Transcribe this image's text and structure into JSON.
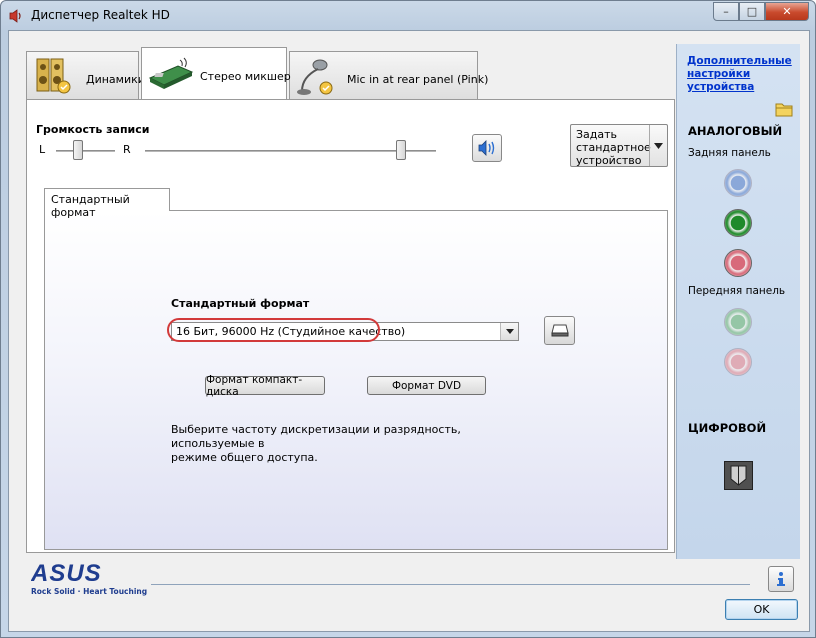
{
  "window": {
    "title": "Диспетчер Realtek HD",
    "min_glyph": "–",
    "max_glyph": "□",
    "close_glyph": "✕"
  },
  "tabs": [
    {
      "label": "Динамики",
      "icon": "speakers-icon",
      "active": false
    },
    {
      "label": "Стерео микшер",
      "icon": "stereo-mixer-icon",
      "active": true
    },
    {
      "label": "Mic in at rear panel (Pink)",
      "icon": "microphone-icon",
      "active": false
    }
  ],
  "recording": {
    "title": "Громкость записи",
    "left_label": "L",
    "right_label": "R",
    "balance_position": 0.5,
    "volume_level": 0.87
  },
  "default_device": {
    "label_line1": "Задать",
    "label_line2": "стандартное",
    "label_line3": "устройство"
  },
  "format": {
    "tab_label": "Стандартный формат",
    "section_title": "Стандартный формат",
    "selected": "16 Бит, 96000 Hz (Студийное качество)",
    "cd_button": "Формат компакт-диска",
    "dvd_button": "Формат DVD",
    "description_line1": "Выберите частоту дискретизации и разрядность, используемые в",
    "description_line2": "режиме общего доступа."
  },
  "sidebar": {
    "link_line1": "Дополнительные",
    "link_line2": "настройки",
    "link_line3": "устройства",
    "analog_heading": "АНАЛОГОВЫЙ",
    "rear_panel": "Задняя панель",
    "front_panel": "Передняя панель",
    "digital_heading": "ЦИФРОВОЙ"
  },
  "jacks": [
    {
      "name": "rear-blue",
      "color": "#7f9fd6",
      "active": false
    },
    {
      "name": "rear-green",
      "color": "#1f8a2a",
      "active": true
    },
    {
      "name": "rear-pink",
      "color": "#d86a7a",
      "active": true
    },
    {
      "name": "front-green",
      "color": "#8cc39a",
      "active": false
    },
    {
      "name": "front-pink",
      "color": "#e3a3ad",
      "active": false
    }
  ],
  "brand": {
    "logo": "ASUS",
    "slogan": "Rock Solid · Heart Touching",
    "color": "#1f3d8f"
  },
  "footer": {
    "ok_label": "OK"
  },
  "colors": {
    "highlight": "#d23a3a",
    "link": "#0033cc"
  }
}
